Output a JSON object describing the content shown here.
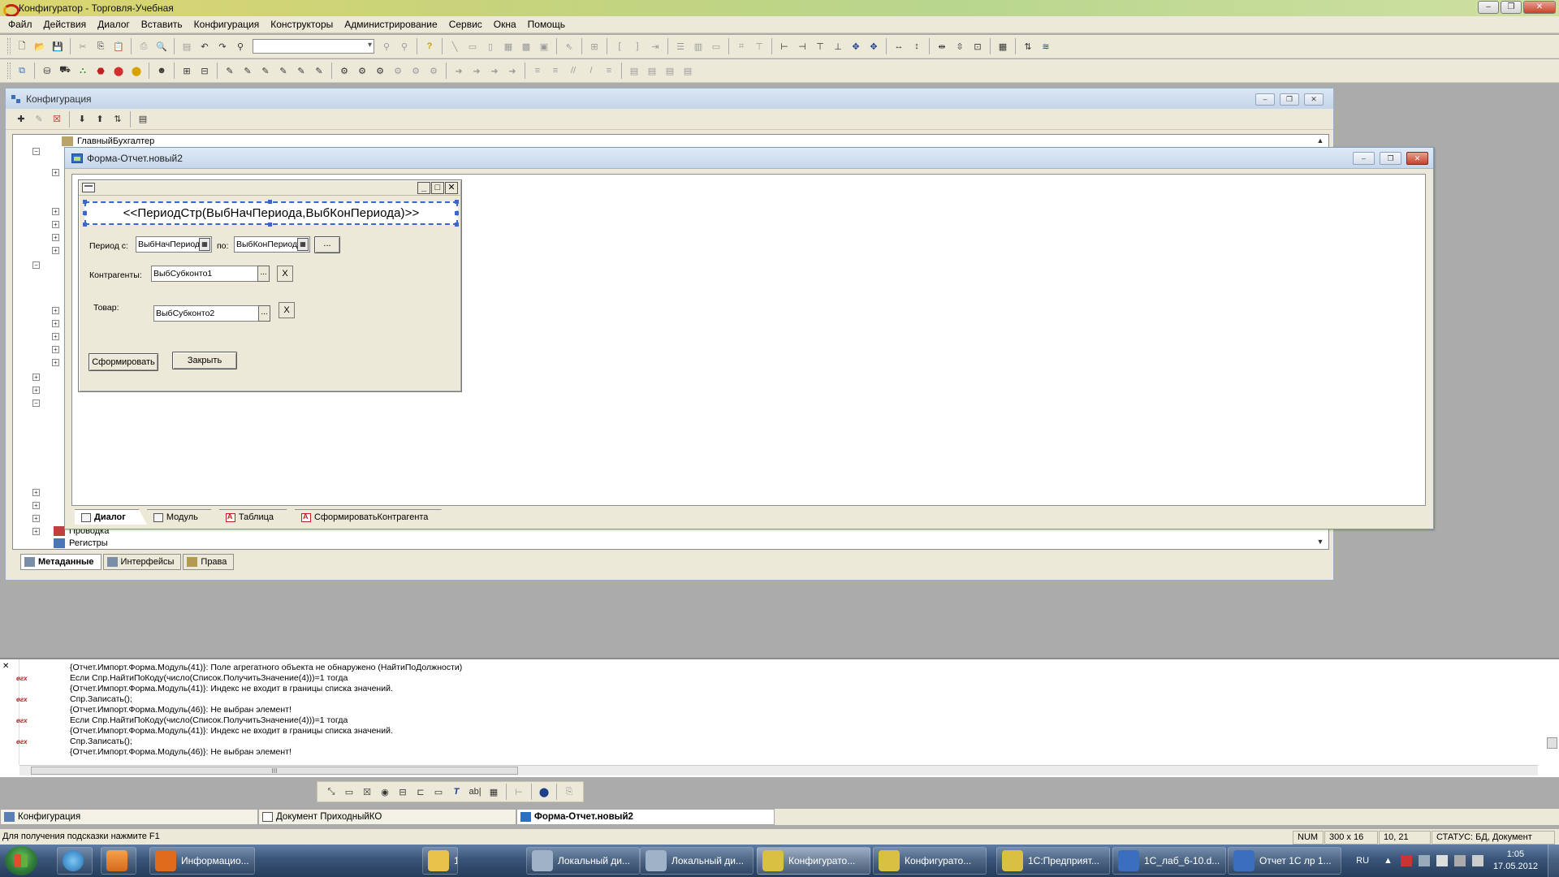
{
  "app": {
    "title": "Конфигуратор - Торговля-Учебная"
  },
  "menu": [
    "Файл",
    "Действия",
    "Диалог",
    "Вставить",
    "Конфигурация",
    "Конструкторы",
    "Администрирование",
    "Сервис",
    "Окна",
    "Помощь"
  ],
  "config_window": {
    "title": "Конфигурация",
    "tree": {
      "top_item": "ГлавныйБухгалтер",
      "bottom_items": [
        "Проводка",
        "Регистры"
      ]
    },
    "tabs": [
      "Метаданные",
      "Интерфейсы",
      "Права"
    ],
    "active_tab": "Метаданные"
  },
  "form_window": {
    "title": "Форма-Отчет.новый2",
    "dialog": {
      "header_text": "<<ПериодСтр(ВыбНачПериода,ВыбКонПериода)>>",
      "period_from_label": "Период с:",
      "period_from_value": "ВыбНачПериода",
      "period_to_label": "по:",
      "period_to_value": "ВыбКонПериода",
      "period_button": "...",
      "contractors_label": "Контрагенты:",
      "contractors_value": "ВыбСубконто1",
      "product_label": "Товар:",
      "product_value": "ВыбСубконто2",
      "lookup_button": "...",
      "clear_button": "X",
      "generate_button": "Сформировать",
      "close_button": "Закрыть"
    },
    "tabs": [
      "Диалог",
      "Модуль",
      "Таблица",
      "СформироватьКонтрагента"
    ],
    "active_tab": "Диалог"
  },
  "messages": {
    "marker": "ѳгх",
    "lines": [
      {
        "text": "{Отчет.Импорт.Форма.Модуль(41)}: Поле агрегатного объекта не обнаружено (НайтиПоДолжности)",
        "mark": false
      },
      {
        "text": "Если Спр.НайтиПоКоду(число(Список.ПолучитьЗначение(4)))=1 тогда",
        "mark": true
      },
      {
        "text": "{Отчет.Импорт.Форма.Модуль(41)}: Индекс не входит в границы списка значений.",
        "mark": false
      },
      {
        "text": "Спр.Записать();",
        "mark": true
      },
      {
        "text": "{Отчет.Импорт.Форма.Модуль(46)}: Не выбран элемент!",
        "mark": false
      },
      {
        "text": "Если Спр.НайтиПоКоду(число(Список.ПолучитьЗначение(4)))=1 тогда",
        "mark": true
      },
      {
        "text": "{Отчет.Импорт.Форма.Модуль(41)}: Индекс не входит в границы списка значений.",
        "mark": false
      },
      {
        "text": "Спр.Записать();",
        "mark": true
      },
      {
        "text": "{Отчет.Импорт.Форма.Модуль(46)}: Не выбран элемент!",
        "mark": false
      }
    ],
    "hscroll_label": "III"
  },
  "bottom_toolbar": {
    "text_icon": "ab|"
  },
  "window_bar": {
    "items": [
      "Конфигурация",
      "Документ ПриходныйКО",
      "Форма-Отчет.новый2"
    ],
    "active": "Форма-Отчет.новый2"
  },
  "status": {
    "hint": "Для получения подсказки нажмите F1",
    "num": "NUM",
    "size": "300 x 16",
    "pos": "10, 21",
    "state": "СТАТУС: БД, Документ"
  },
  "taskbar": {
    "apps": [
      {
        "label": "Информацио...",
        "color": "#e06b1d"
      },
      {
        "label": "1С",
        "color": "#e8c24a"
      },
      {
        "label": "Локальный ди...",
        "color": "#9fb2c8"
      },
      {
        "label": "Локальный ди...",
        "color": "#9fb2c8"
      },
      {
        "label": "Конфигурато...",
        "color": "#d8c040"
      },
      {
        "label": "Конфигурато...",
        "color": "#d8c040"
      },
      {
        "label": "1С:Предприят...",
        "color": "#d8c040"
      },
      {
        "label": "1С_лаб_6-10.d...",
        "color": "#3a6fc0"
      },
      {
        "label": "Отчет 1С лр 1...",
        "color": "#3a6fc0"
      }
    ],
    "lang": "RU",
    "time": "1:05",
    "date": "17.05.2012"
  }
}
